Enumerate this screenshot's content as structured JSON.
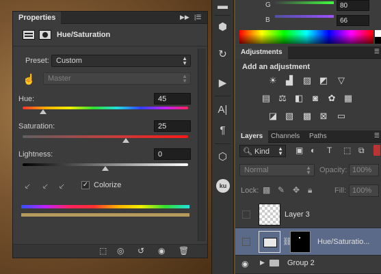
{
  "properties_panel": {
    "tab_label": "Properties",
    "title": "Hue/Saturation",
    "preset_label": "Preset:",
    "preset_value": "Custom",
    "channel_value": "Master",
    "hue_label": "Hue:",
    "hue_value": "45",
    "hue_level": 0.125,
    "saturation_label": "Saturation:",
    "saturation_value": "25",
    "saturation_level": 0.625,
    "lightness_label": "Lightness:",
    "lightness_value": "0",
    "lightness_level": 0.5,
    "colorize_label": "Colorize",
    "colorize_checked": true,
    "colorize_color": "#b59a5e"
  },
  "color_panel": {
    "g_label": "G",
    "g_value": "80",
    "b_label": "B",
    "b_value": "66"
  },
  "adjustments_panel": {
    "tab_label": "Adjustments",
    "heading": "Add an adjustment"
  },
  "layers_panel": {
    "tabs": [
      "Layers",
      "Channels",
      "Paths"
    ],
    "kind_value": "Kind",
    "blend_mode": "Normal",
    "opacity_label": "Opacity:",
    "opacity_value": "100%",
    "lock_label": "Lock:",
    "fill_label": "Fill:",
    "fill_value": "100%",
    "layers": [
      {
        "name": "Layer 3"
      },
      {
        "name": "Hue/Saturatio..."
      },
      {
        "name": "Group 2"
      }
    ],
    "selection_color": "#5a6a88"
  }
}
